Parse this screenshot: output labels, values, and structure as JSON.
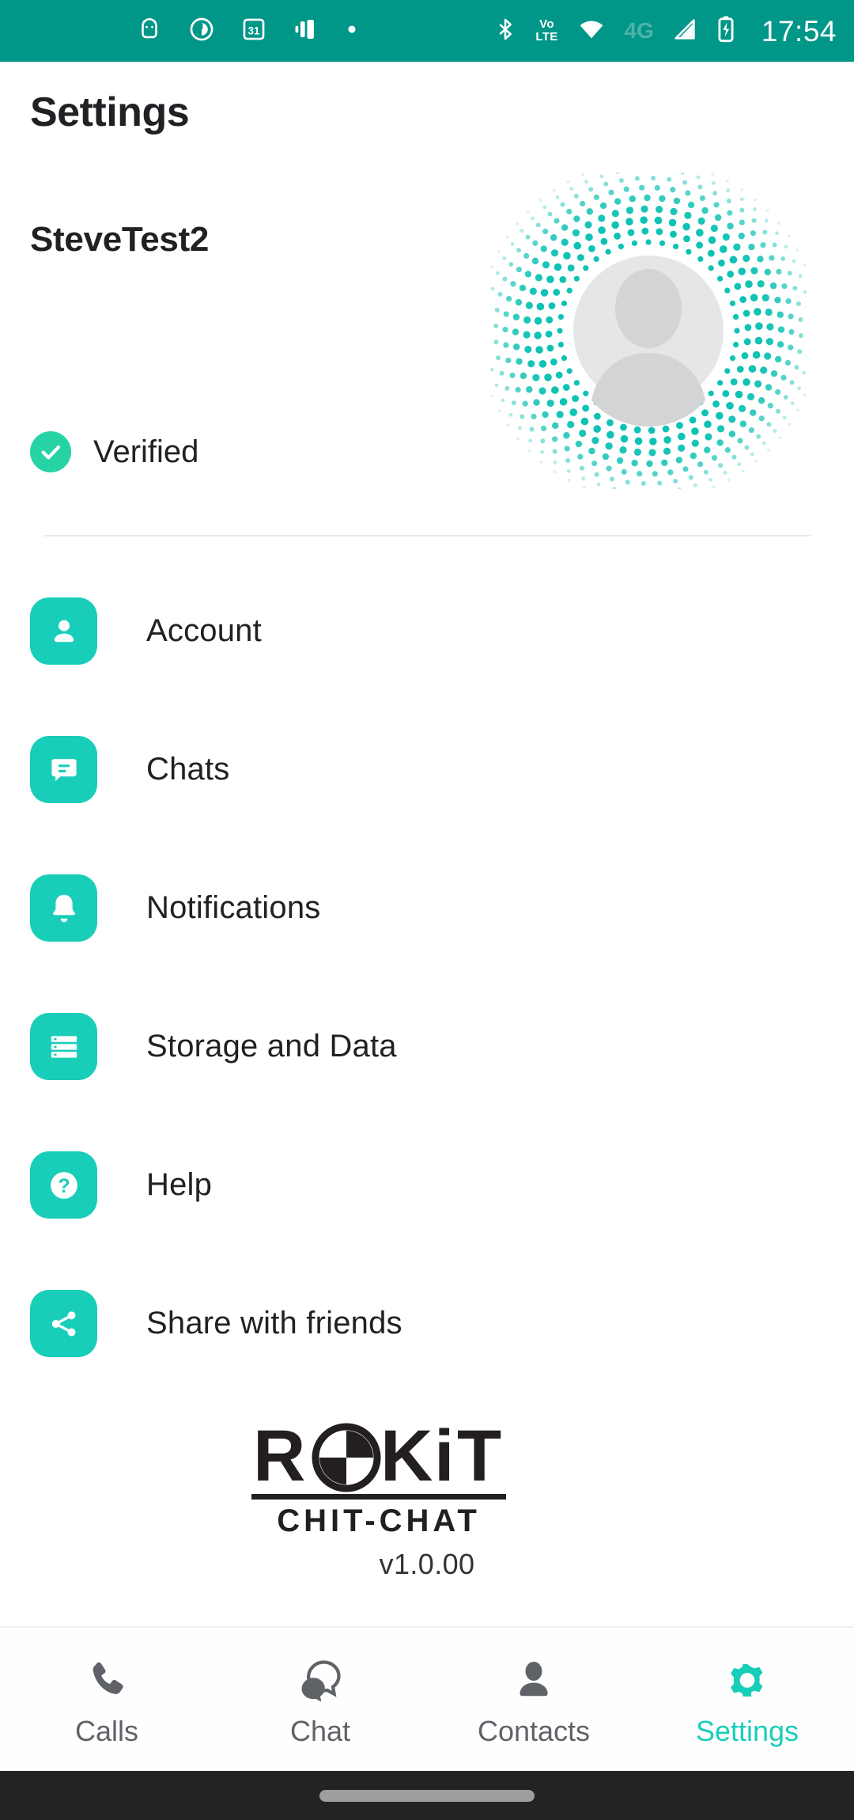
{
  "status_bar": {
    "time": "17:54",
    "network_type": "4G",
    "volte_top": "Vo",
    "volte_bottom": "LTE",
    "background_color": "#009688",
    "left_icons": [
      "android-debug-icon",
      "clock-alarm-icon",
      "calendar-31-icon",
      "vibrate-icon",
      "dot-icon"
    ],
    "right_icons": [
      "bluetooth-icon",
      "volte-icon",
      "wifi-icon",
      "4g-icon",
      "signal-icon",
      "battery-charging-icon"
    ]
  },
  "header": {
    "title": "Settings",
    "user_name": "SteveTest2"
  },
  "profile": {
    "avatar_alt": "default-avatar-placeholder",
    "halo_color": "#0ec2b4",
    "verified": {
      "label": "Verified",
      "badge_color": "#26d3a4",
      "icon": "check-icon"
    }
  },
  "menu": {
    "items": [
      {
        "label": "Account",
        "icon": "person-icon"
      },
      {
        "label": "Chats",
        "icon": "chat-bubble-icon"
      },
      {
        "label": "Notifications",
        "icon": "bell-icon"
      },
      {
        "label": "Storage and Data",
        "icon": "storage-list-icon"
      },
      {
        "label": "Help",
        "icon": "question-mark-icon"
      },
      {
        "label": "Share with friends",
        "icon": "share-nodes-icon"
      }
    ],
    "icon_color": "#19CEB9"
  },
  "brand": {
    "name": "ROKiT",
    "sub_name": "CHIT-CHAT",
    "version": "v1.0.00"
  },
  "bottom_nav": {
    "active_color": "#19CEB9",
    "inactive_color": "#5f6368",
    "items": [
      {
        "label": "Calls",
        "icon": "phone-icon",
        "active": false
      },
      {
        "label": "Chat",
        "icon": "chat-icon",
        "active": false
      },
      {
        "label": "Contacts",
        "icon": "contact-icon",
        "active": false
      },
      {
        "label": "Settings",
        "icon": "gear-icon",
        "active": true
      }
    ]
  }
}
